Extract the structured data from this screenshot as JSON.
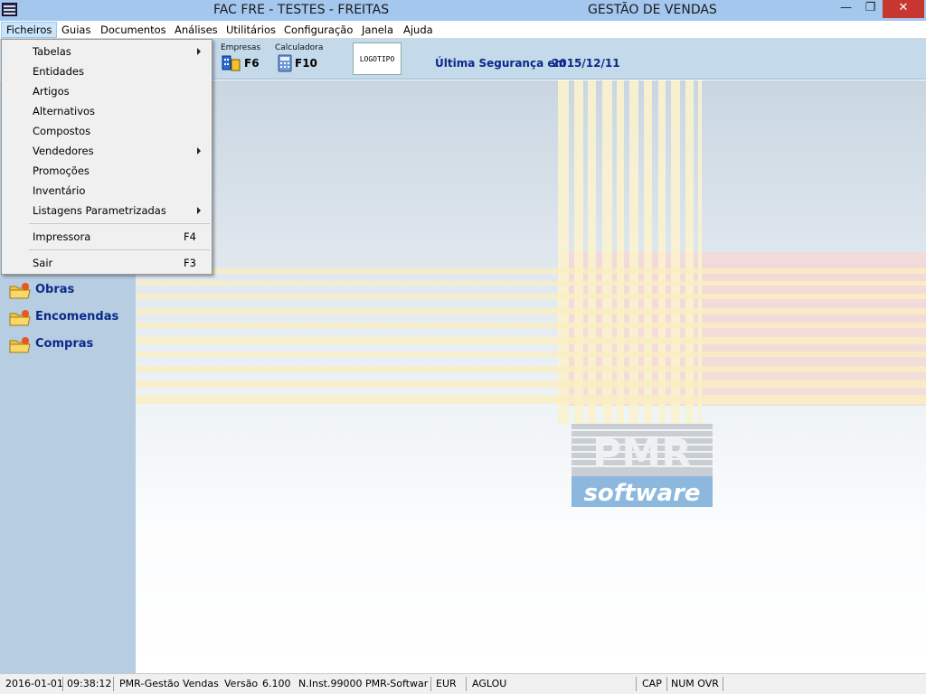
{
  "titlebar": {
    "left_title": "FAC FRE - TESTES - FREITAS",
    "right_title": "GESTÃO DE VENDAS",
    "minimize_glyph": "—",
    "restore_glyph": "❐",
    "close_glyph": "✕"
  },
  "menu": [
    {
      "label": "Ficheiros"
    },
    {
      "label": "Guias"
    },
    {
      "label": "Documentos"
    },
    {
      "label": "Análises"
    },
    {
      "label": "Utilitários"
    },
    {
      "label": "Configuração"
    },
    {
      "label": "Janela"
    },
    {
      "label": "Ajuda"
    }
  ],
  "toolbar": {
    "empresas_label": "Empresas",
    "empresas_key": "F6",
    "calculadora_label": "Calculadora",
    "calculadora_key": "F10",
    "logo_text": "LOGOTIPO",
    "backup_label": "Última Segurança em",
    "backup_date": "2015/12/11"
  },
  "dropdown": {
    "items": [
      {
        "label": "Tabelas",
        "submenu": true
      },
      {
        "label": "Entidades"
      },
      {
        "label": "Artigos"
      },
      {
        "label": "Alternativos"
      },
      {
        "label": "Compostos"
      },
      {
        "label": "Vendedores",
        "submenu": true
      },
      {
        "label": "Promoções"
      },
      {
        "label": "Inventário"
      },
      {
        "label": "Listagens Parametrizadas",
        "submenu": true
      },
      {
        "label": "Impressora",
        "shortcut": "F4"
      },
      {
        "label": "Sair",
        "shortcut": "F3"
      }
    ]
  },
  "sidebar": {
    "items": [
      {
        "label": "Obras",
        "icon": "folder-star-icon"
      },
      {
        "label": "Encomendas",
        "icon": "folder-star-icon"
      },
      {
        "label": "Compras",
        "icon": "folder-star-icon"
      }
    ]
  },
  "watermark": {
    "brand_top": "PMR",
    "brand_bottom": "software"
  },
  "statusbar": {
    "date": "2016-01-01",
    "time": "09:38:12",
    "app": "PMR-Gestão Vendas",
    "version_label": "Versão",
    "version": "6.100",
    "install": "N.Inst.99000",
    "vendor": "PMR-Softwar",
    "currency": "EUR",
    "user": "AGLOU",
    "cap": "CAP",
    "num_ovr": "NUM OVR"
  },
  "colors": {
    "titlebar": "#a4c7ee",
    "close_button": "#c7372f",
    "toolbar": "#c4d9ea",
    "sidebar": "#b7cde2",
    "nav_text": "#0a2a8a",
    "menu_active": "#cce4f7"
  }
}
